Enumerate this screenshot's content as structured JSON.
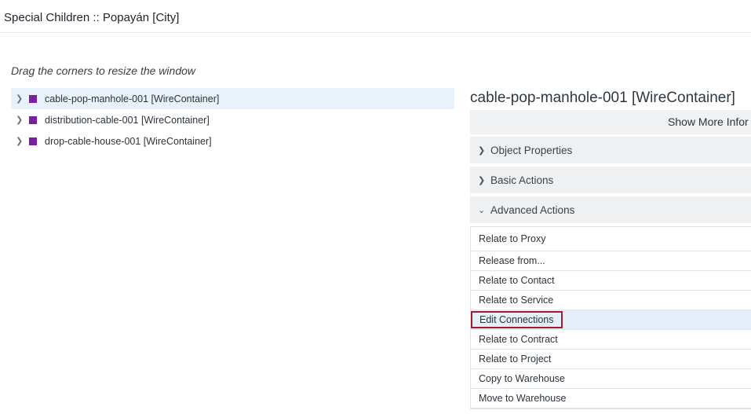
{
  "window": {
    "title": "Special Children :: Popayán [City]",
    "hint": "Drag the corners to resize the window"
  },
  "tree": {
    "items": [
      {
        "label": "cable-pop-manhole-001 [WireContainer]",
        "selected": true,
        "color": "#7a1fa2",
        "icon": "chevron-right-icon"
      },
      {
        "label": "distribution-cable-001 [WireContainer]",
        "selected": false,
        "color": "#7a1fa2",
        "icon": "chevron-right-icon"
      },
      {
        "label": "drop-cable-house-001 [WireContainer]",
        "selected": false,
        "color": "#7a1fa2",
        "icon": "chevron-right-icon"
      }
    ]
  },
  "detail": {
    "title": "cable-pop-manhole-001 [WireContainer]",
    "show_more": "Show More Infor",
    "sections": [
      {
        "label": "Object Properties",
        "expanded": false,
        "icon": "chevron-right-icon"
      },
      {
        "label": "Basic Actions",
        "expanded": false,
        "icon": "chevron-right-icon"
      },
      {
        "label": "Advanced Actions",
        "expanded": true,
        "icon": "chevron-down-icon"
      }
    ],
    "actions": [
      "Relate to Proxy",
      "Release from...",
      "Relate to Contact",
      "Relate to Service",
      "Edit Connections",
      "Relate to Contract",
      "Relate to Project",
      "Copy to Warehouse",
      "Move to Warehouse"
    ],
    "highlighted_action": "Edit Connections",
    "highlight_color": "#a11d2e"
  }
}
